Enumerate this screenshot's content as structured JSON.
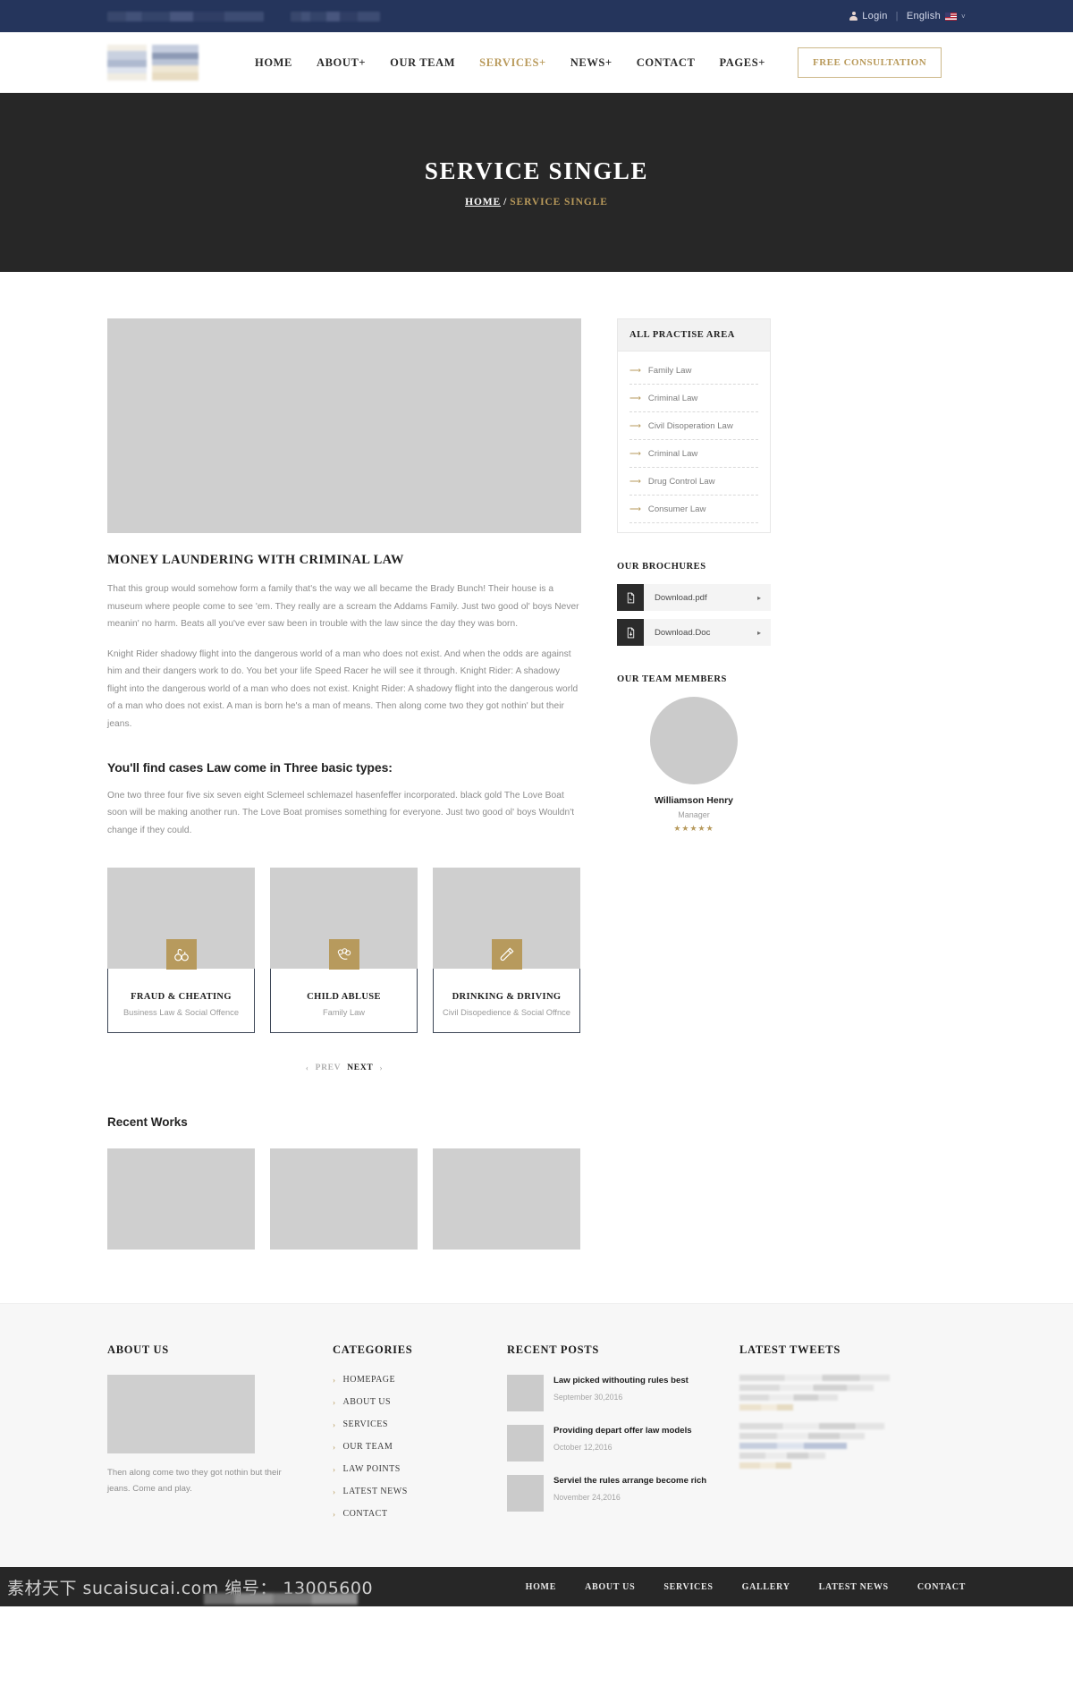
{
  "topbar": {
    "login_label": "Login",
    "separator": "|",
    "language_label": "English",
    "caret": "˅"
  },
  "header": {
    "nav": [
      {
        "label": "HOME",
        "active": false
      },
      {
        "label": "ABOUT+",
        "active": false
      },
      {
        "label": "OUR TEAM",
        "active": false
      },
      {
        "label": "SERVICES+",
        "active": true
      },
      {
        "label": "NEWS+",
        "active": false
      },
      {
        "label": "CONTACT",
        "active": false
      },
      {
        "label": "PAGES+",
        "active": false
      }
    ],
    "cta_label": "FREE CONSULTATION"
  },
  "banner": {
    "title": "SERVICE SINGLE",
    "breadcrumb_home": "HOME",
    "breadcrumb_sep": "/",
    "breadcrumb_current": "SERVICE SINGLE"
  },
  "article": {
    "title": "MONEY LAUNDERING WITH CRIMINAL LAW",
    "paragraph_1": "That this group would somehow form a family that's the way we all became the Brady Bunch! Their house is a museum where people come to see 'em. They really are a scream the Addams Family. Just two good ol' boys Never meanin' no harm. Beats all you've ever saw been in trouble with the law since the day they was born.",
    "paragraph_2": "Knight Rider shadowy flight into the dangerous world of a man who does not exist. And when the odds are against him and their dangers work to do. You bet your life Speed Racer he will see it through. Knight Rider: A shadowy flight into the dangerous world of a man who does not exist. Knight Rider: A shadowy flight into the dangerous world of a man who does not exist. A man is born he's a man of means. Then along come two they got nothin' but their jeans.",
    "subheading": "You'll find cases Law come in Three basic types:",
    "paragraph_3": "One two three four five six seven eight Sclemeel schlemazel hasenfeffer incorporated. black gold The Love Boat soon will be making another run. The Love Boat promises something for everyone. Just two good ol' boys Wouldn't change if they could."
  },
  "cards": [
    {
      "icon": "handcuffs-icon",
      "title": "FRAUD & CHEATING",
      "subtitle": "Business Law & Social Offence"
    },
    {
      "icon": "knuckles-icon",
      "title": "CHILD ABLUSE",
      "subtitle": "Family Law"
    },
    {
      "icon": "bottle-icon",
      "title": "DRINKING & DRIVING",
      "subtitle": "Civil Disopedience & Social Offnce"
    }
  ],
  "pager": {
    "prev_arrow": "‹",
    "prev_label": "PREV",
    "next_label": "NEXT",
    "next_arrow": "›"
  },
  "recent_works": {
    "title": "Recent Works",
    "items": [
      "work-1",
      "work-2",
      "work-3"
    ]
  },
  "sidebar": {
    "practise_title": "ALL PRACTISE AREA",
    "practise_items": [
      "Family Law",
      "Criminal Law",
      "Civil Disoperation Law",
      "Criminal Law",
      "Drug Control Law",
      "Consumer Law"
    ],
    "brochures_title": "OUR BROCHURES",
    "brochures": [
      {
        "label": "Download.pdf",
        "icon": "pdf-file-icon",
        "arrow": "▸"
      },
      {
        "label": "Download.Doc",
        "icon": "doc-file-icon",
        "arrow": "▸"
      }
    ],
    "team_title": "OUR TEAM MEMBERS",
    "team_member": {
      "name": "Williamson Henry",
      "role": "Manager",
      "stars": "★★★★★"
    }
  },
  "footer": {
    "about_title": "ABOUT US",
    "about_text": "Then along come two they got nothin but their jeans. Come and play.",
    "categories_title": "CATEGORIES",
    "categories": [
      "HOMEPAGE",
      "ABOUT US",
      "SERVICES",
      "OUR TEAM",
      "LAW POINTS",
      "LATEST NEWS",
      "CONTACT"
    ],
    "posts_title": "RECENT POSTS",
    "posts": [
      {
        "title": "Law picked withouting rules best",
        "date": "September 30,2016"
      },
      {
        "title": "Providing depart offer law models",
        "date": "October 12,2016"
      },
      {
        "title": "Serviel the rules arrange become rich",
        "date": "November 24,2016"
      }
    ],
    "tweets_title": "LATEST TWEETS"
  },
  "bottombar": {
    "links": [
      "HOME",
      "ABOUT US",
      "SERVICES",
      "GALLERY",
      "LATEST NEWS",
      "CONTACT"
    ]
  },
  "watermark": {
    "text": "素材天下 sucaisucai.com  编号： 13005600"
  },
  "colors": {
    "topbar_bg": "#25355c",
    "banner_bg": "#272727",
    "accent_gold": "#b79a5d",
    "card_border": "#3c4656",
    "placeholder": "#cfcfcf"
  }
}
